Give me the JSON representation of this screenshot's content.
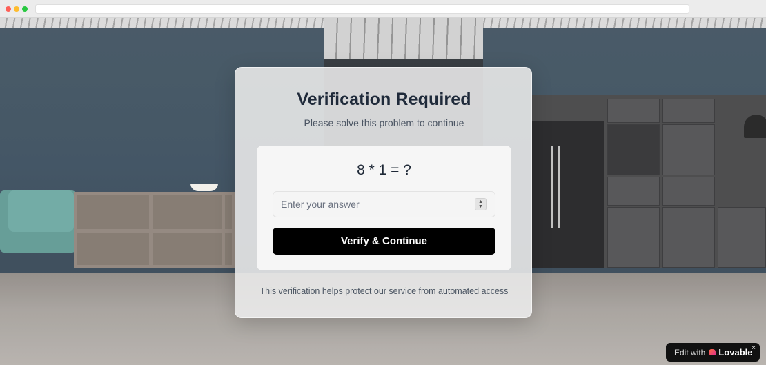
{
  "card": {
    "title": "Verification Required",
    "subtitle": "Please solve this problem to continue",
    "problem": "8 * 1 = ?",
    "answer_placeholder": "Enter your answer",
    "answer_value": "",
    "submit_label": "Verify & Continue",
    "footer_note": "This verification helps protect our service from automated access"
  },
  "badge": {
    "prefix": "Edit with",
    "brand": "Lovable",
    "close_glyph": "×"
  },
  "icons": {
    "stepper_up": "▲",
    "stepper_down": "▼"
  }
}
